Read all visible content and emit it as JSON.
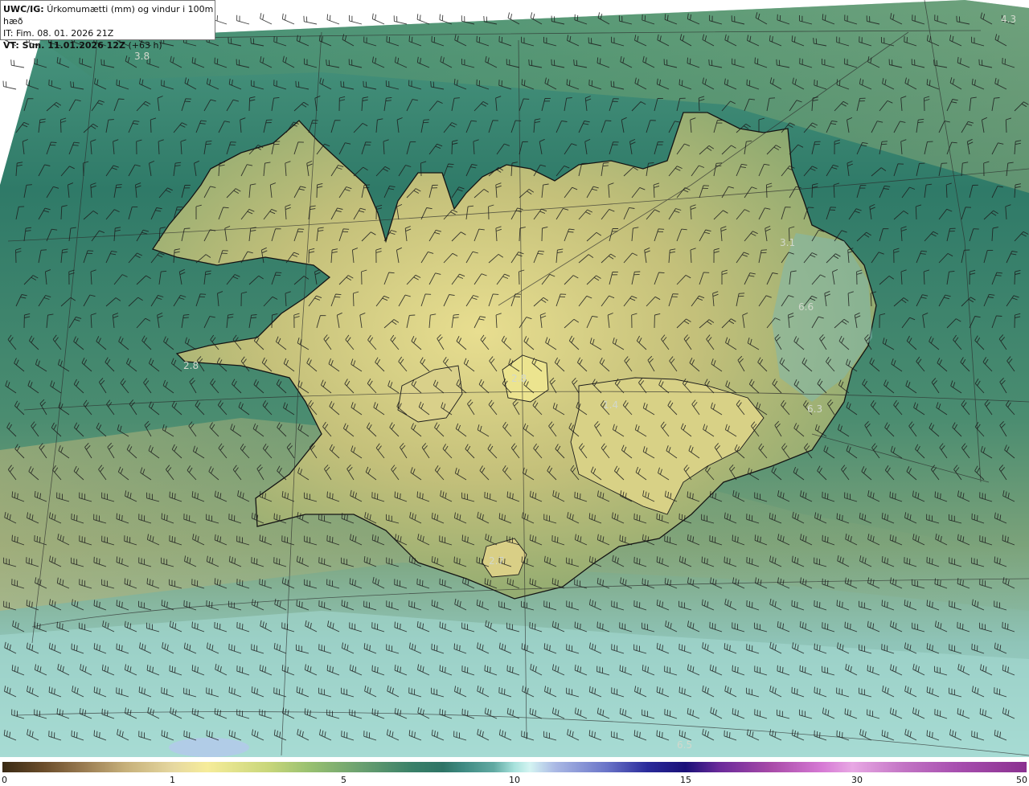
{
  "header": {
    "product": "UWC/IG:",
    "title": "Úrkomumætti (mm) og vindur i 100m hæð",
    "init_time": "IT: Fim. 08. 01. 2026 21Z",
    "valid_time": "VT: Sun. 11.01.2026 12Z",
    "lead_time": "(+63 h)"
  },
  "colorbar": {
    "ticks": [
      "0",
      "1",
      "5",
      "10",
      "15",
      "30",
      "50"
    ]
  },
  "map_labels": [
    {
      "text": "4.3"
    },
    {
      "text": "3.8"
    },
    {
      "text": "3.1"
    },
    {
      "text": "6.6"
    },
    {
      "text": "2.8"
    },
    {
      "text": "2.8"
    },
    {
      "text": "1.4"
    },
    {
      "text": "6.3"
    },
    {
      "text": "2.7"
    },
    {
      "text": "6.5"
    }
  ],
  "colors": {
    "ocean_dark": "#2d7766",
    "ocean_light": "#9fd6cf",
    "land_light": "#e4dc8c",
    "coast_line": "#111111"
  }
}
